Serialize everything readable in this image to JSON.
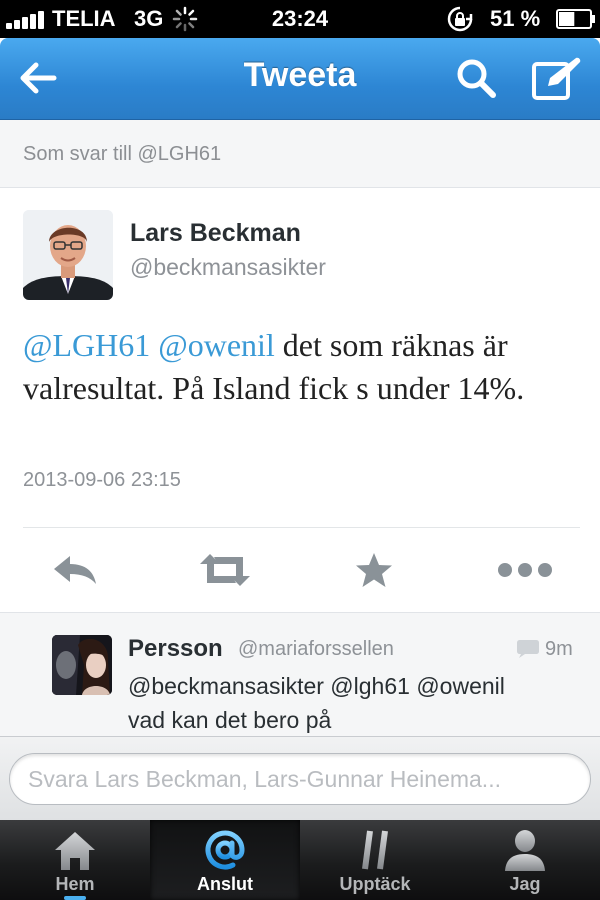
{
  "status_bar": {
    "carrier": "TELIA",
    "network": "3G",
    "time": "23:24",
    "battery_percent": "51 %",
    "signal_icon": "signal-bars-icon",
    "battery_level": 0.51
  },
  "nav": {
    "title": "Tweeta",
    "back_icon": "back-arrow-icon",
    "search_icon": "search-icon",
    "compose_icon": "compose-icon"
  },
  "reply_context": "Som svar till @LGH61",
  "tweet": {
    "author_name": "Lars Beckman",
    "author_handle": "@beckmansasikter",
    "mention_1": "@LGH61",
    "mention_2": "@owenil",
    "text": " det som räknas är valresultat. På Island fick s under 14%.",
    "timestamp": "2013-09-06 23:15",
    "mention_color": "#3a9ad6"
  },
  "actions": [
    {
      "icon": "reply-icon"
    },
    {
      "icon": "retweet-icon"
    },
    {
      "icon": "favorite-star-icon"
    },
    {
      "icon": "more-icon"
    }
  ],
  "reply": {
    "name": "Persson",
    "handle": "@mariaforssellen",
    "time": "9m",
    "text_line_1": "@beckmansasikter @lgh61 @owenil",
    "text_line_2": "vad kan det bero på"
  },
  "compose": {
    "placeholder": "Svara Lars Beckman, Lars-Gunnar Heinema..."
  },
  "tabs": [
    {
      "label": "Hem",
      "icon": "home-icon",
      "active": false
    },
    {
      "label": "Anslut",
      "icon": "at-icon",
      "active": true
    },
    {
      "label": "Upptäck",
      "icon": "hashtag-icon",
      "active": false
    },
    {
      "label": "Jag",
      "icon": "person-icon",
      "active": false
    }
  ],
  "colors": {
    "nav_blue": "#2d86d4",
    "link_blue": "#3a9ad6",
    "active_tab_icon": "#4ab0f0"
  }
}
